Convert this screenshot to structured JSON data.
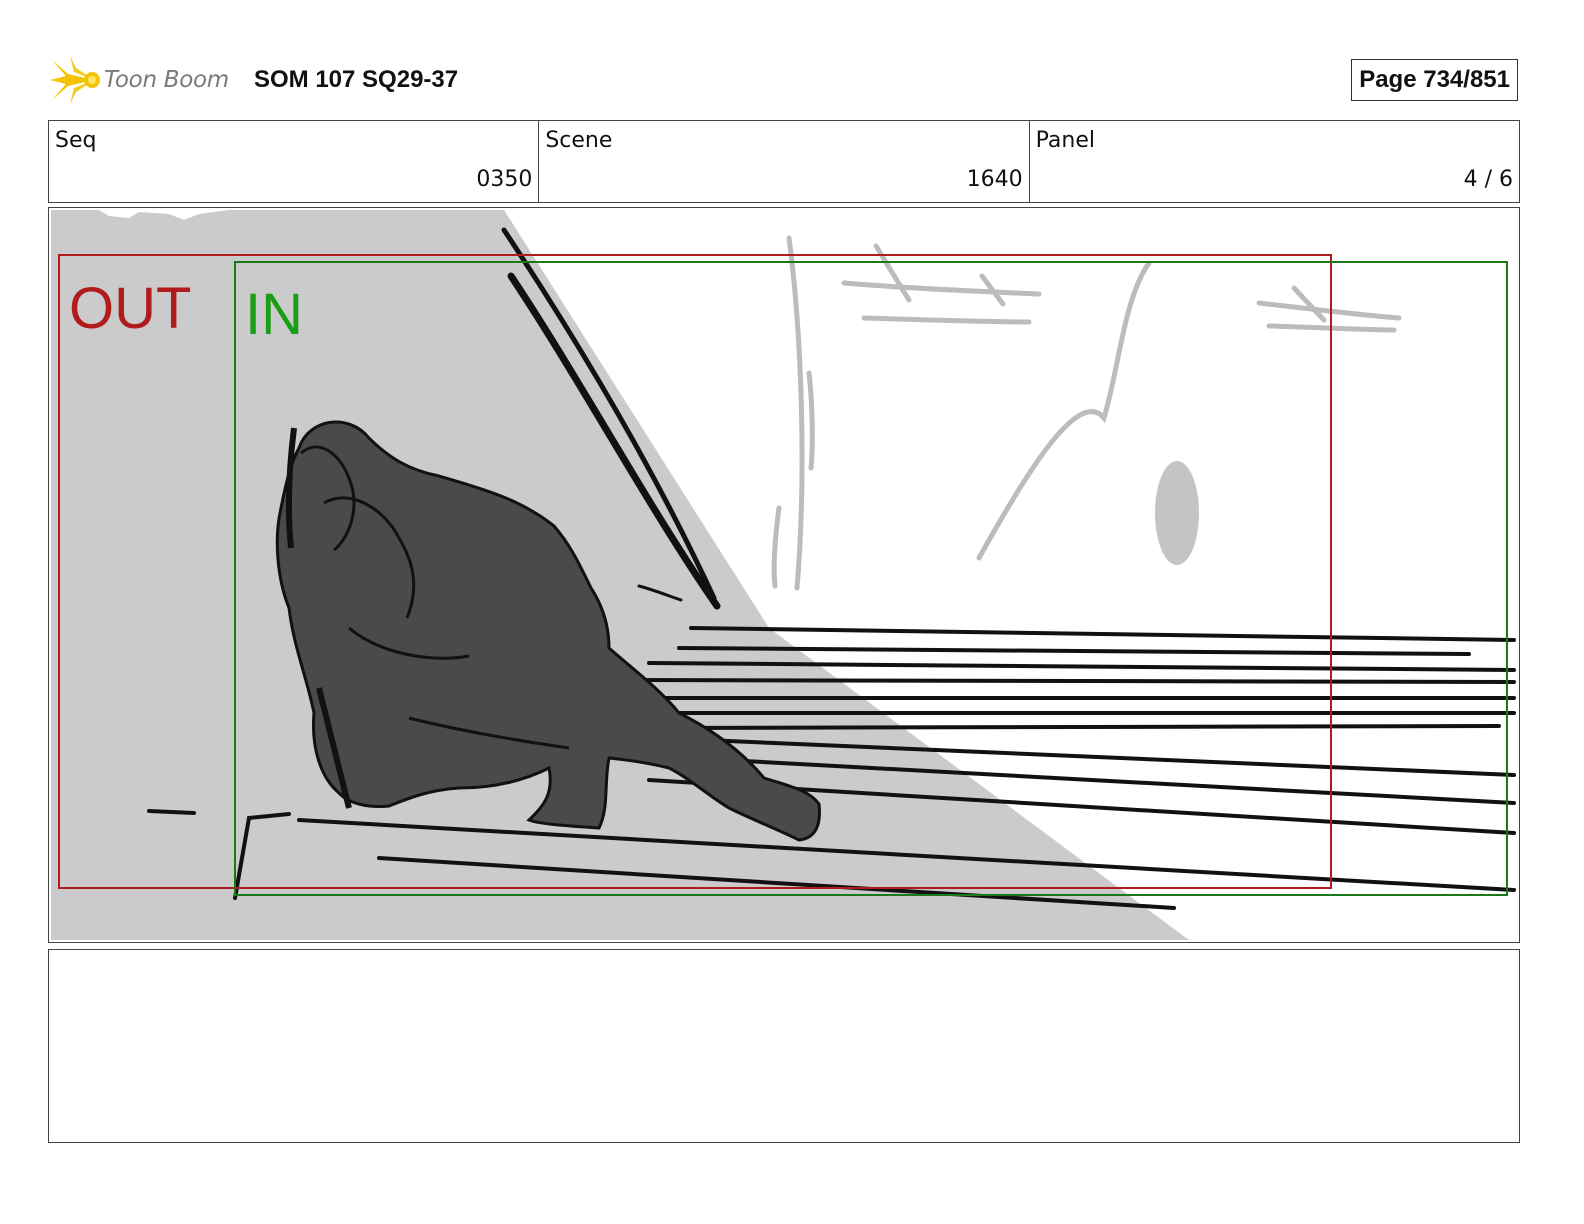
{
  "header": {
    "logo_text": "Toon Boom",
    "logo_color": "#f5c400",
    "project_title": "SOM 107 SQ29-37",
    "page_indicator": "Page 734/851"
  },
  "info": {
    "seq_label": "Seq",
    "seq_value": "0350",
    "scene_label": "Scene",
    "scene_value": "1640",
    "panel_label": "Panel",
    "panel_value": "4 / 6"
  },
  "panel_image": {
    "out_label": "OUT",
    "in_label": "IN",
    "out_color": "#b01c1c",
    "in_color": "#1a9e1a"
  },
  "notes": {
    "text": ""
  }
}
